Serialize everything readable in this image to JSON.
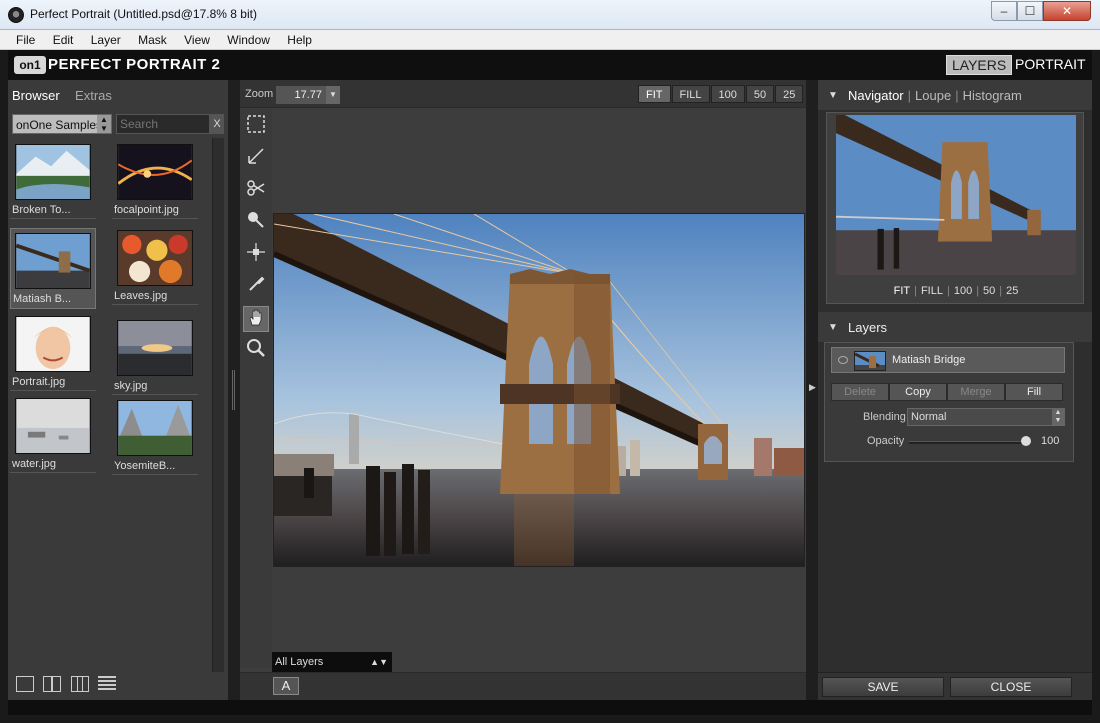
{
  "window": {
    "title": "Perfect Portrait (Untitled.psd@17.8% 8 bit)",
    "min": "–",
    "max": "☐",
    "close": "✕"
  },
  "menu": [
    "File",
    "Edit",
    "Layer",
    "Mask",
    "View",
    "Window",
    "Help"
  ],
  "brand": {
    "logo": "on1",
    "name": "PERFECT PORTRAIT 2",
    "mode_layers": "LAYERS",
    "mode_portrait": "PORTRAIT"
  },
  "browser": {
    "tabs": [
      "Browser",
      "Extras"
    ],
    "source": "onOne Samples",
    "search_placeholder": "Search",
    "search_clear": "X",
    "thumbnails": [
      {
        "caption": "Broken To...",
        "selected": false
      },
      {
        "caption": "focalpoint.jpg",
        "selected": false
      },
      {
        "caption": "Matiash B...",
        "selected": true
      },
      {
        "caption": "Leaves.jpg",
        "selected": false
      },
      {
        "caption": "Portrait.jpg",
        "selected": false
      },
      {
        "caption": "sky.jpg",
        "selected": false
      },
      {
        "caption": "water.jpg",
        "selected": false
      },
      {
        "caption": "YosemiteB...",
        "selected": false
      }
    ]
  },
  "canvas": {
    "zoom_label": "Zoom",
    "zoom_value": "17.77",
    "presets": [
      "FIT",
      "FILL",
      "100",
      "50",
      "25"
    ],
    "layer_dropdown": "All Layers",
    "a_button": "A"
  },
  "navigator": {
    "tabs": [
      "Navigator",
      "Loupe",
      "Histogram"
    ],
    "presets": [
      "FIT",
      "FILL",
      "100",
      "50",
      "25"
    ]
  },
  "layers": {
    "title": "Layers",
    "layer_name": "Matiash Bridge",
    "actions": [
      "Delete",
      "Copy",
      "Merge",
      "Fill"
    ],
    "blending_label": "Blending",
    "blending_value": "Normal",
    "opacity_label": "Opacity",
    "opacity_value": "100"
  },
  "footer": {
    "save": "SAVE",
    "close": "CLOSE"
  }
}
